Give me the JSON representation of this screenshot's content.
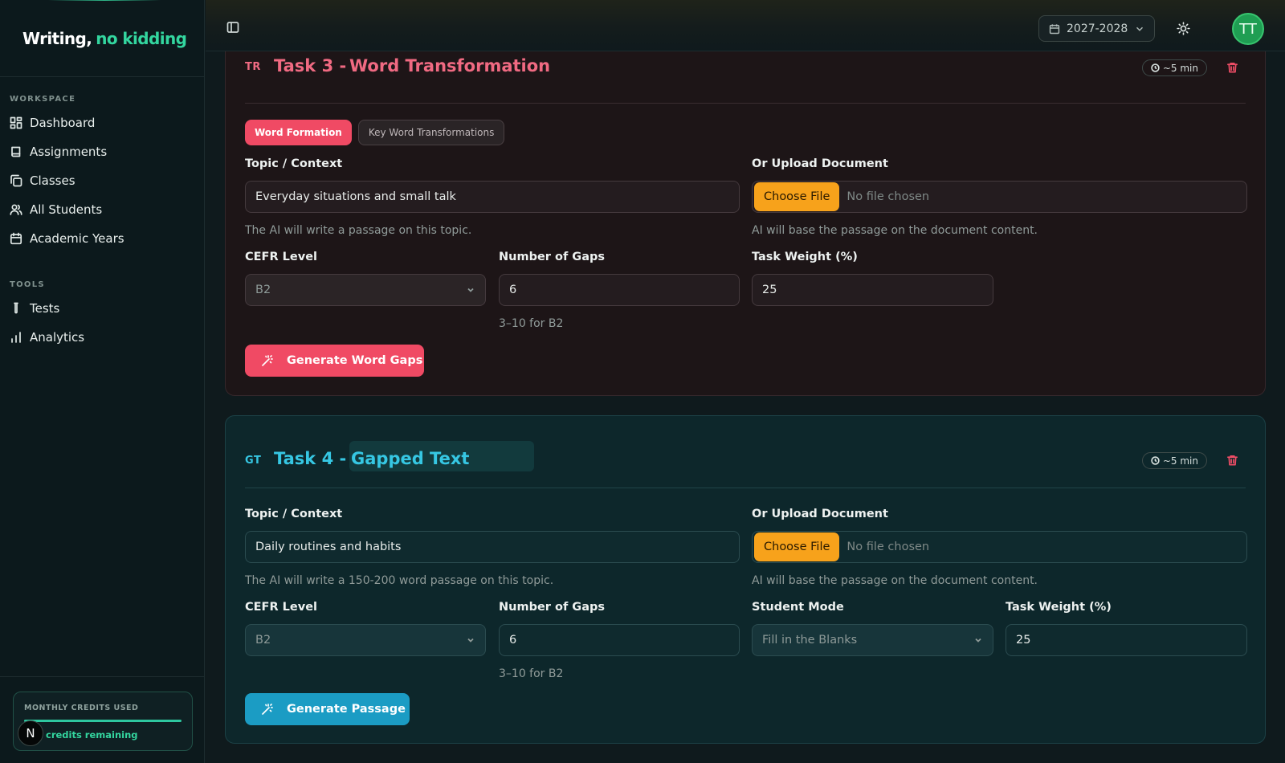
{
  "app": {
    "logo_part1": "Writing,",
    "logo_part2": "no kidding"
  },
  "sidebar": {
    "workspace_heading": "WORKSPACE",
    "workspace_items": [
      {
        "label": "Dashboard",
        "icon": "dashboard-icon"
      },
      {
        "label": "Assignments",
        "icon": "book-icon"
      },
      {
        "label": "Classes",
        "icon": "copy-icon"
      },
      {
        "label": "All Students",
        "icon": "users-icon"
      },
      {
        "label": "Academic Years",
        "icon": "calendar-icon"
      }
    ],
    "tools_heading": "TOOLS",
    "tools_items": [
      {
        "label": "Tests",
        "icon": "test-tube-icon"
      },
      {
        "label": "Analytics",
        "icon": "bar-chart-icon"
      }
    ],
    "credits": {
      "label": "MONTHLY CREDITS USED",
      "used_fraction": 1.0,
      "remaining_text": "credits remaining",
      "badge": "N"
    }
  },
  "topbar": {
    "academic_year": "2027-2028",
    "avatar_initials": "TT"
  },
  "task3": {
    "code": "TR",
    "number": "Task 3 -",
    "name": "Word Transformation",
    "time": "~5 min",
    "chips": [
      "Word Formation",
      "Key Word Transformations"
    ],
    "topic_label": "Topic / Context",
    "topic_value": "Everyday situations and small talk",
    "topic_helper": "The AI will write a passage on this topic.",
    "upload_label": "Or Upload Document",
    "choose_file": "Choose File",
    "no_file": "No file chosen",
    "upload_helper": "AI will base the passage on the document content.",
    "cefr_label": "CEFR Level",
    "cefr_value": "B2",
    "gaps_label": "Number of Gaps",
    "gaps_value": "6",
    "gaps_helper": "3–10 for B2",
    "weight_label": "Task Weight (%)",
    "weight_value": "25",
    "generate_label": "Generate Word Gaps"
  },
  "task4": {
    "code": "GT",
    "number": "Task 4 -",
    "name": "Gapped Text",
    "time": "~5 min",
    "topic_label": "Topic / Context",
    "topic_value": "Daily routines and habits",
    "topic_helper": "The AI will write a 150-200 word passage on this topic.",
    "upload_label": "Or Upload Document",
    "choose_file": "Choose File",
    "no_file": "No file chosen",
    "upload_helper": "AI will base the passage on the document content.",
    "cefr_label": "CEFR Level",
    "cefr_value": "B2",
    "gaps_label": "Number of Gaps",
    "gaps_value": "6",
    "gaps_helper": "3–10 for B2",
    "mode_label": "Student Mode",
    "mode_value": "Fill in the Blanks",
    "weight_label": "Task Weight (%)",
    "weight_value": "25",
    "generate_label": "Generate Passage"
  },
  "colors": {
    "brand_green": "#33d69f",
    "task3_accent": "#f04a64",
    "task4_accent": "#1b9cc4",
    "file_button": "#f7a21b"
  }
}
